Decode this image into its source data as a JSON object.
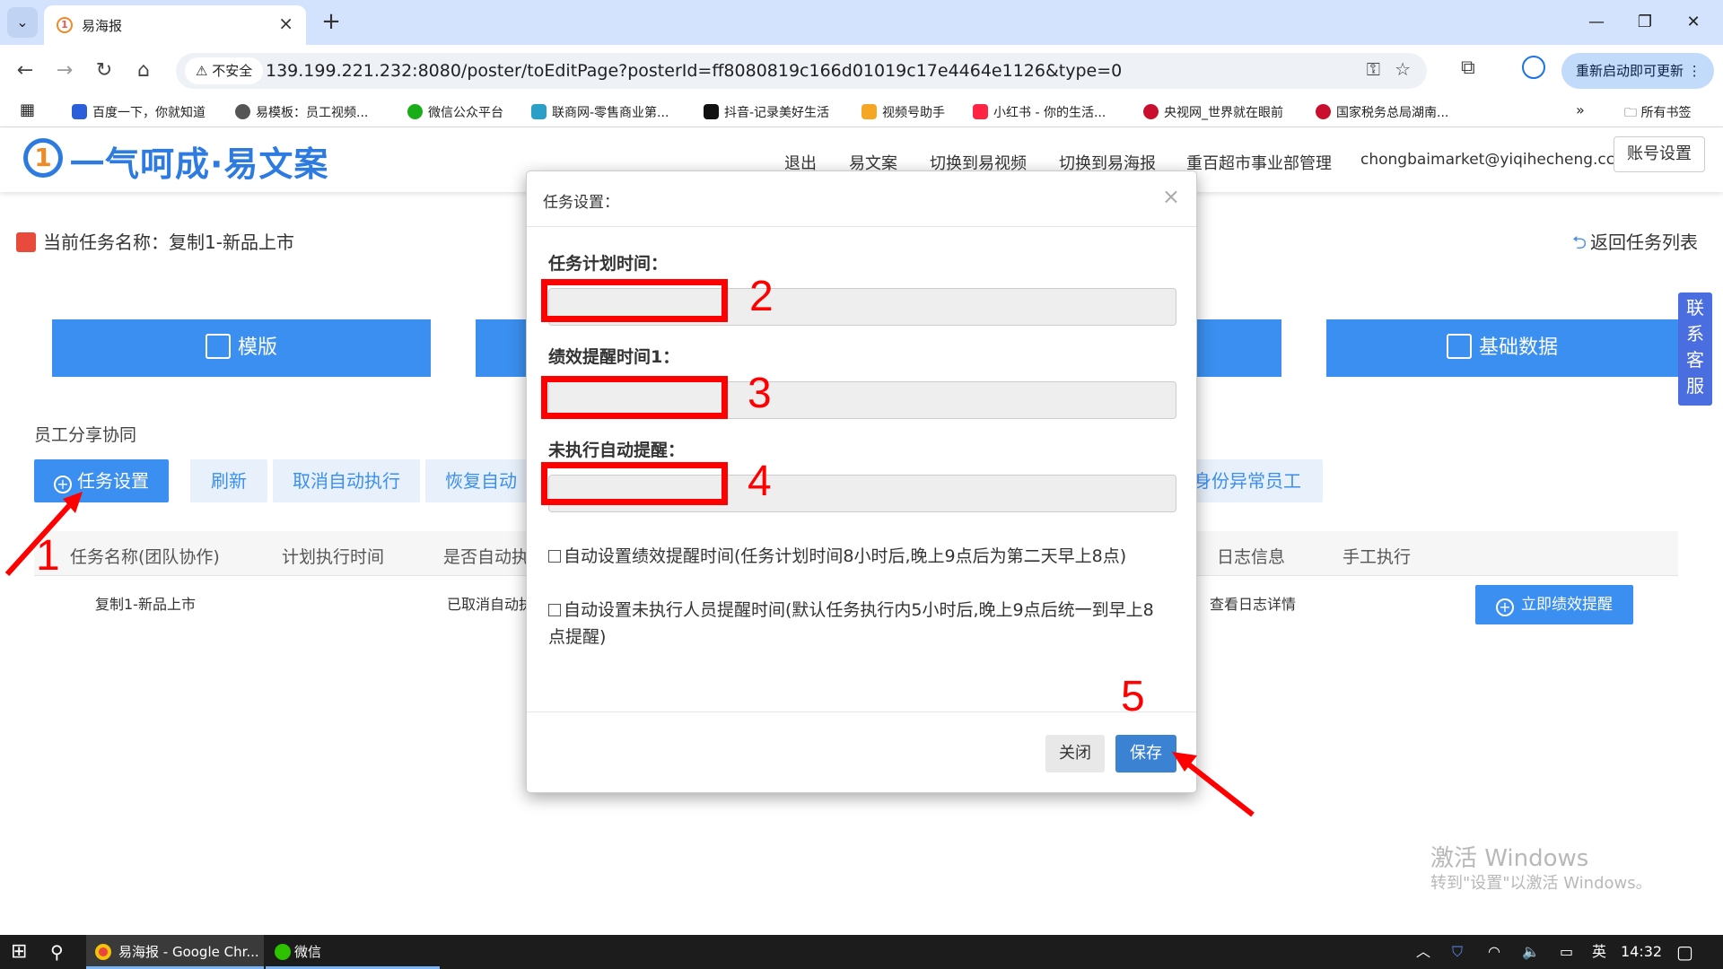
{
  "browser": {
    "tab_title": "易海报",
    "url": "139.199.221.232:8080/poster/toEditPage?posterId=ff8080819c166d01019c17e4464e1126&type=0",
    "insecure_label": "不安全",
    "update_label": "重新启动即可更新",
    "bookmarks": [
      {
        "label": "百度一下，你就知道",
        "color": "#2b5fd9"
      },
      {
        "label": "易模板：员工视频...",
        "color": "#555555"
      },
      {
        "label": "微信公众平台",
        "color": "#1aad19"
      },
      {
        "label": "联商网-零售商业第...",
        "color": "#2aa0c8"
      },
      {
        "label": "抖音-记录美好生活",
        "color": "#111111"
      },
      {
        "label": "视频号助手",
        "color": "#f5a623"
      },
      {
        "label": "小红书 - 你的生活...",
        "color": "#ff2442"
      },
      {
        "label": "央视网_世界就在眼前",
        "color": "#c8102e"
      },
      {
        "label": "国家税务总局湖南...",
        "color": "#c8102e"
      }
    ],
    "all_bookmarks": "所有书签"
  },
  "site": {
    "logo_text": "一气呵成·易文案",
    "nav": [
      "退出",
      "易文案",
      "切换到易视频",
      "切换到易海报",
      "重百超市事业部管理",
      "chongbaimarket@yiqihecheng.cc"
    ],
    "account_label": "账号设置",
    "task_name": "当前任务名称：复制1-新品上市",
    "back_label": "返回任务列表",
    "big_buttons": [
      "模版",
      "基础数据"
    ],
    "service_tab": [
      "联",
      "系",
      "客",
      "服"
    ],
    "section_label": "员工分享协同",
    "action_buttons": [
      "任务设置",
      "刷新",
      "取消自动执行",
      "恢复自动执",
      "身份异常员工"
    ],
    "table_headers": [
      "任务名称(团队协作)",
      "计划执行时间",
      "是否自动执",
      "日志信息",
      "手工执行"
    ],
    "row": {
      "name": "复制1-新品上市",
      "auto": "已取消自动执",
      "log": "查看日志详情",
      "action": "立即绩效提醒"
    },
    "watermark_title": "激活 Windows",
    "watermark_sub": "转到\"设置\"以激活 Windows。"
  },
  "modal": {
    "title": "任务设置：",
    "fields": [
      {
        "label": "任务计划时间：",
        "value": ""
      },
      {
        "label": "绩效提醒时间1：",
        "value": ""
      },
      {
        "label": "未执行自动提醒：",
        "value": ""
      }
    ],
    "checkbox1": "自动设置绩效提醒时间(任务计划时间8小时后,晚上9点后为第二天早上8点)",
    "checkbox2": "自动设置未执行人员提醒时间(默认任务执行内5小时后,晚上9点后统一到早上8点提醒)",
    "close_label": "关闭",
    "save_label": "保存"
  },
  "annotations": [
    "1",
    "2",
    "3",
    "4",
    "5"
  ],
  "taskbar": {
    "chrome_label": "易海报 - Google Chr...",
    "wechat_label": "微信",
    "ime": "英",
    "time": "14:32"
  }
}
